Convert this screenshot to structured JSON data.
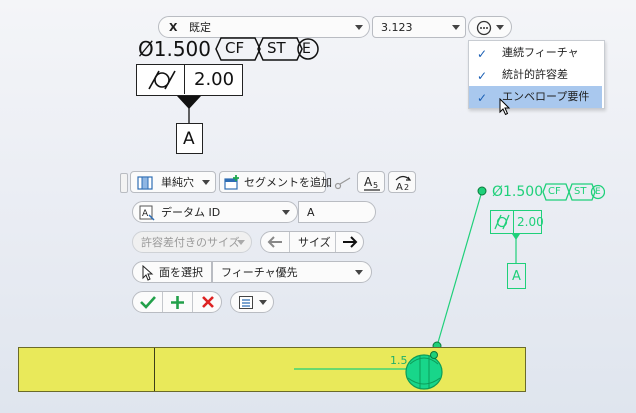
{
  "top_bar": {
    "axis": "X",
    "mode_value": "既定",
    "numeric_value": "3.123"
  },
  "more_menu": {
    "items": [
      {
        "label": "連続フィーチャ",
        "checked": true
      },
      {
        "label": "統計的許容差",
        "checked": true
      },
      {
        "label": "エンベロープ要件",
        "checked": true
      }
    ]
  },
  "dimension": {
    "value": "Ø1.500",
    "modifiers": [
      "CF",
      "ST",
      "E"
    ],
    "tolerance_value": "2.00",
    "datum": "A"
  },
  "toolbar": {
    "hole_type": "単純穴",
    "add_segment_label": "セグメントを追加"
  },
  "datum_row": {
    "label": "データム ID",
    "value": "A"
  },
  "size_row": {
    "toleranced_label": "許容差付きのサイズ",
    "size_label": "サイズ"
  },
  "face_row": {
    "select_face_label": "面を選択",
    "feature_priority": "フィーチャ優先"
  },
  "model": {
    "dimension_text": "1.5",
    "colors": {
      "model_yellow": "#e9e95a",
      "annotation_green": "#1fd07a",
      "selection_blue": "#a9c8ee"
    }
  }
}
